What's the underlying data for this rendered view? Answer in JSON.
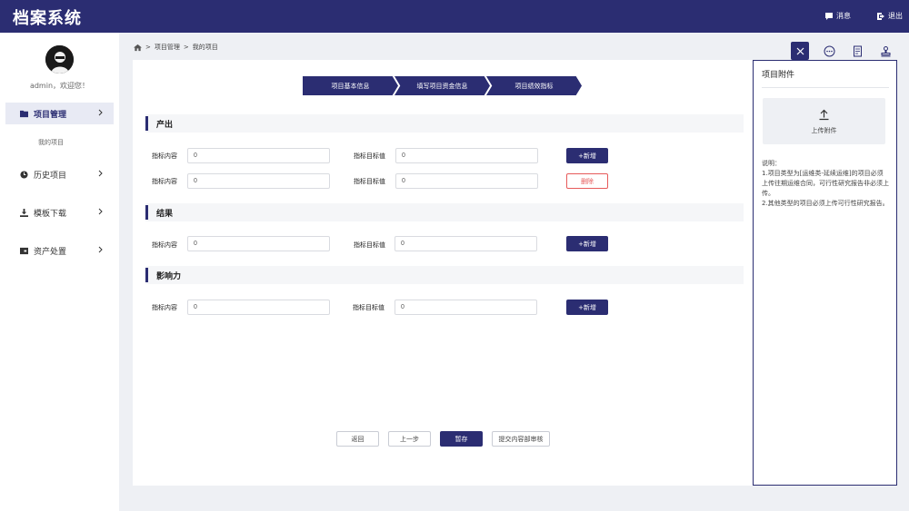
{
  "app": {
    "title": "档案系统"
  },
  "topbar": {
    "messages_label": "消息",
    "logout_label": "退出"
  },
  "user": {
    "greeting": "admin，欢迎您！"
  },
  "sidebar": {
    "items": [
      {
        "label": "项目管理",
        "icon": "folder-icon"
      },
      {
        "label": "历史项目",
        "icon": "clock-icon"
      },
      {
        "label": "模板下载",
        "icon": "download-icon"
      },
      {
        "label": "资产处置",
        "icon": "asset-icon"
      }
    ],
    "sub_items": [
      {
        "label": "我的项目"
      }
    ]
  },
  "breadcrumb": {
    "items": [
      "项目管理",
      "我的项目"
    ]
  },
  "steps": [
    "项目基本信息",
    "填写项目资金信息",
    "项目绩效指标"
  ],
  "sections": [
    {
      "title": "产出",
      "rows": [
        {
          "content_label": "指标内容",
          "content_value": "0",
          "target_label": "指标目标值",
          "target_value": "0",
          "action": "+新增"
        },
        {
          "content_label": "指标内容",
          "content_value": "0",
          "target_label": "指标目标值",
          "target_value": "0",
          "action": "删除"
        }
      ]
    },
    {
      "title": "结果",
      "rows": [
        {
          "content_label": "指标内容",
          "content_value": "0",
          "target_label": "指标目标值",
          "target_value": "0",
          "action": "+新增"
        }
      ]
    },
    {
      "title": "影响力",
      "rows": [
        {
          "content_label": "指标内容",
          "content_value": "0",
          "target_label": "指标目标值",
          "target_value": "0",
          "action": "+新增"
        }
      ]
    }
  ],
  "footer_buttons": {
    "back": "返回",
    "prev": "上一步",
    "save": "暂存",
    "submit": "提交内容部审核"
  },
  "attachment_panel": {
    "title": "项目附件",
    "upload_label": "上传附件",
    "notes": [
      "说明：",
      "1.项目类型为[运维类-延续运维]的项目必须上传往期运维合同，可行性研究报告非必须上传。",
      "2.其他类型的项目必须上传可行性研究报告。"
    ]
  },
  "colors": {
    "primary": "#2b2d72",
    "danger": "#e65a5a",
    "background": "#eef0f4"
  }
}
